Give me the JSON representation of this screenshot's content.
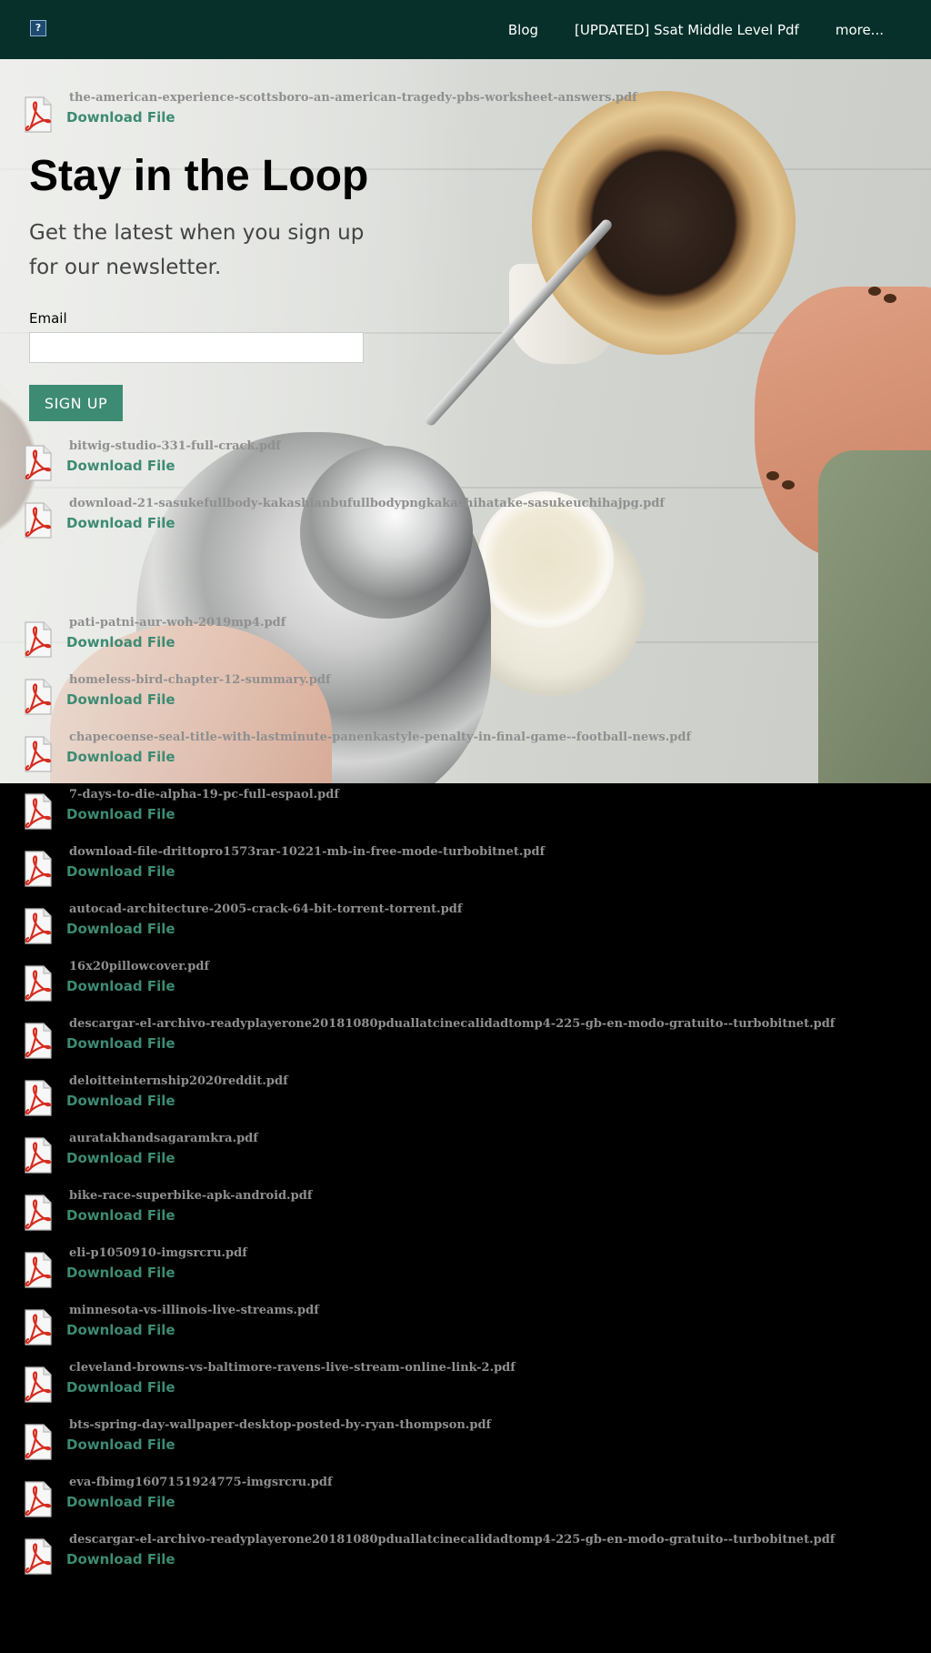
{
  "nav": {
    "logo_glyph": "?",
    "links": [
      "Blog",
      "[UPDATED] Ssat Middle Level Pdf",
      "more..."
    ]
  },
  "newsletter": {
    "title": "Stay in the Loop",
    "subtitle": "Get the latest when you sign up for our newsletter.",
    "email_label": "Email",
    "email_value": "",
    "button_label": "SIGN UP"
  },
  "download_label": "Download File",
  "files": [
    "the-american-experience-scottsboro-an-american-tragedy-pbs-worksheet-answers.pdf",
    "bitwig-studio-331-full-crack.pdf",
    "download-21-sasukefullbody-kakashianbufullbodypngkakashihatake-sasukeuchihajpg.pdf",
    "pati-patni-aur-woh-2019mp4.pdf",
    "homeless-bird-chapter-12-summary.pdf",
    "chapecoense-seal-title-with-lastminute-panenkastyle-penalty-in-final-game--football-news.pdf",
    "7-days-to-die-alpha-19-pc-full-espaol.pdf",
    "download-file-drittopro1573rar-10221-mb-in-free-mode-turbobitnet.pdf",
    "autocad-architecture-2005-crack-64-bit-torrent-torrent.pdf",
    "16x20pillowcover.pdf",
    "descargar-el-archivo-readyplayerone20181080pduallatcinecalidadtomp4-225-gb-en-modo-gratuito--turbobitnet.pdf",
    "deloitteinternship2020reddit.pdf",
    "auratakhandsagaramkra.pdf",
    "bike-race-superbike-apk-android.pdf",
    "eli-p1050910-imgsrcru.pdf",
    "minnesota-vs-illinois-live-streams.pdf",
    "cleveland-browns-vs-baltimore-ravens-live-stream-online-link-2.pdf",
    "bts-spring-day-wallpaper-desktop-posted-by-ryan-thompson.pdf",
    "eva-fbimg1607151924775-imgsrcru.pdf",
    "descargar-el-archivo-readyplayerone20181080pduallatcinecalidadtomp4-225-gb-en-modo-gratuito--turbobitnet.pdf"
  ],
  "colors": {
    "nav_bg": "#07302a",
    "accent": "#3d8b73",
    "file_name": "#8f8f8f",
    "page_bg": "#000000"
  },
  "icons": {
    "file": "pdf-icon",
    "logo": "broken-image-icon"
  }
}
